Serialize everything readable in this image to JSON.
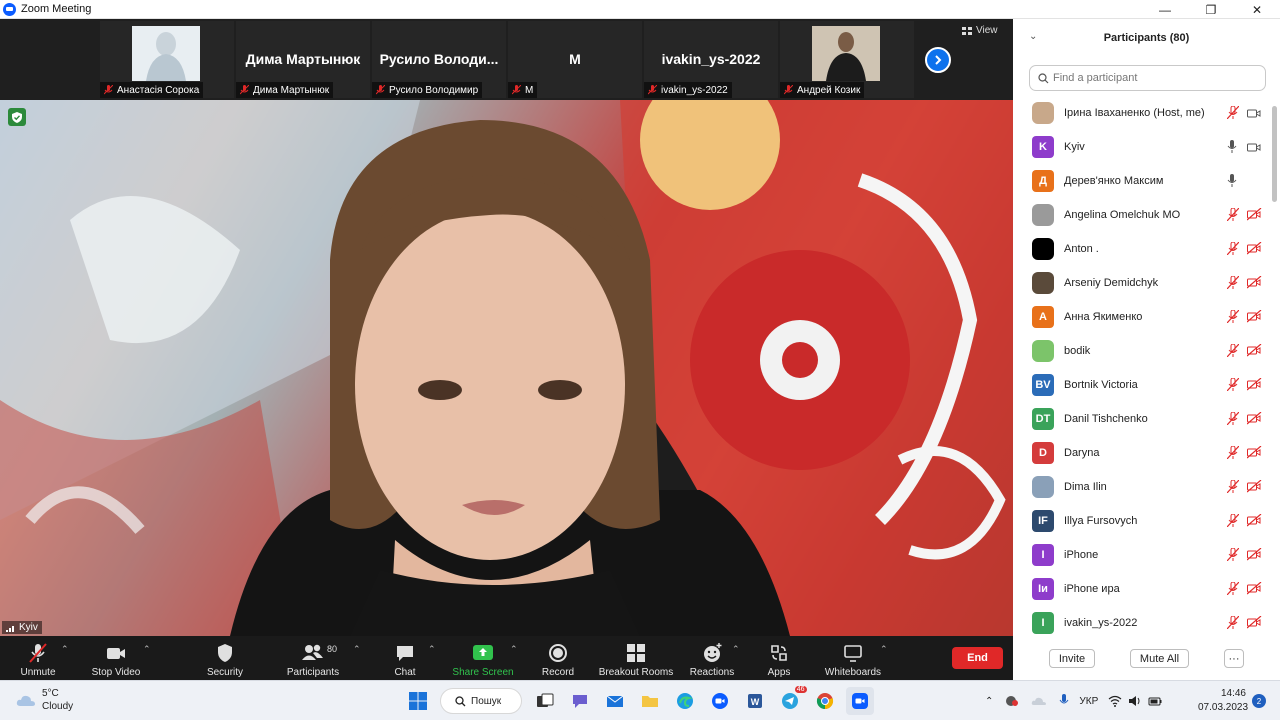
{
  "window": {
    "title": "Zoom Meeting"
  },
  "gallery": {
    "thumbs": [
      {
        "big_name": "",
        "label": "Анастасія Сорока"
      },
      {
        "big_name": "Дима Мартынюк",
        "label": "Дима Мартынюк"
      },
      {
        "big_name": "Русило  Володи...",
        "label": "Русило Володимир"
      },
      {
        "big_name": "M",
        "label": "M"
      },
      {
        "big_name": "ivakin_ys-2022",
        "label": "ivakin_ys-2022"
      },
      {
        "big_name": "",
        "label": "Андрей Козик"
      }
    ],
    "view_label": "View"
  },
  "speaker": {
    "name": "Kyiv"
  },
  "toolbar": {
    "unmute": "Unmute",
    "stop_video": "Stop Video",
    "security": "Security",
    "participants": "Participants",
    "participants_count": "80",
    "chat": "Chat",
    "share_screen": "Share Screen",
    "record": "Record",
    "breakout": "Breakout Rooms",
    "reactions": "Reactions",
    "apps": "Apps",
    "whiteboards": "Whiteboards",
    "end": "End"
  },
  "panel": {
    "title": "Participants (80)",
    "search_placeholder": "Find a participant",
    "participants": [
      {
        "name": "Ірина Іваханенко (Host, me)",
        "initials": "",
        "color": "#c8a88a",
        "mic": "off",
        "cam": "on"
      },
      {
        "name": "Kyiv",
        "initials": "K",
        "color": "#8e3ccb",
        "mic": "on",
        "cam": "on"
      },
      {
        "name": "Дерев'янко Максим",
        "initials": "Д",
        "color": "#e8711a",
        "mic": "on",
        "cam": "none"
      },
      {
        "name": "Angelina Omelchuk MO",
        "initials": "",
        "color": "#9a9a9a",
        "mic": "off",
        "cam": "off"
      },
      {
        "name": "Anton .",
        "initials": "",
        "color": "#000000",
        "mic": "off",
        "cam": "off"
      },
      {
        "name": "Arseniy Demidchyk",
        "initials": "",
        "color": "#5a4a3a",
        "mic": "off",
        "cam": "off"
      },
      {
        "name": "Анна Якименко",
        "initials": "А",
        "color": "#e8711a",
        "mic": "off",
        "cam": "off"
      },
      {
        "name": "bodik",
        "initials": "",
        "color": "#7cc46a",
        "mic": "off",
        "cam": "off"
      },
      {
        "name": "Bortnik Victoria",
        "initials": "BV",
        "color": "#2b6cb8",
        "mic": "off",
        "cam": "off"
      },
      {
        "name": "Danil Tishchenko",
        "initials": "DT",
        "color": "#3aa35a",
        "mic": "off",
        "cam": "off"
      },
      {
        "name": "Daryna",
        "initials": "D",
        "color": "#d43c3c",
        "mic": "off",
        "cam": "off"
      },
      {
        "name": "Dima Ilin",
        "initials": "",
        "color": "#8aa0b8",
        "mic": "off",
        "cam": "off"
      },
      {
        "name": "Illya Fursovych",
        "initials": "IF",
        "color": "#2d4a6e",
        "mic": "off",
        "cam": "off"
      },
      {
        "name": "iPhone",
        "initials": "I",
        "color": "#8e3ccb",
        "mic": "off",
        "cam": "off"
      },
      {
        "name": "iPhone ира",
        "initials": "Iи",
        "color": "#8e3ccb",
        "mic": "off",
        "cam": "off"
      },
      {
        "name": "ivakin_ys-2022",
        "initials": "I",
        "color": "#3aa35a",
        "mic": "off",
        "cam": "off"
      }
    ],
    "invite": "Invite",
    "mute_all": "Mute All",
    "more": "···"
  },
  "taskbar": {
    "temperature": "5°C",
    "condition": "Cloudy",
    "search": "Пошук",
    "telegram_badge": "46",
    "language": "УКР",
    "time": "14:46",
    "date": "07.03.2023",
    "notifications": "2"
  },
  "colors": {
    "accent": "#0e72ed",
    "end": "#e02828",
    "share": "#31c24d",
    "muted_red": "#e02828"
  }
}
